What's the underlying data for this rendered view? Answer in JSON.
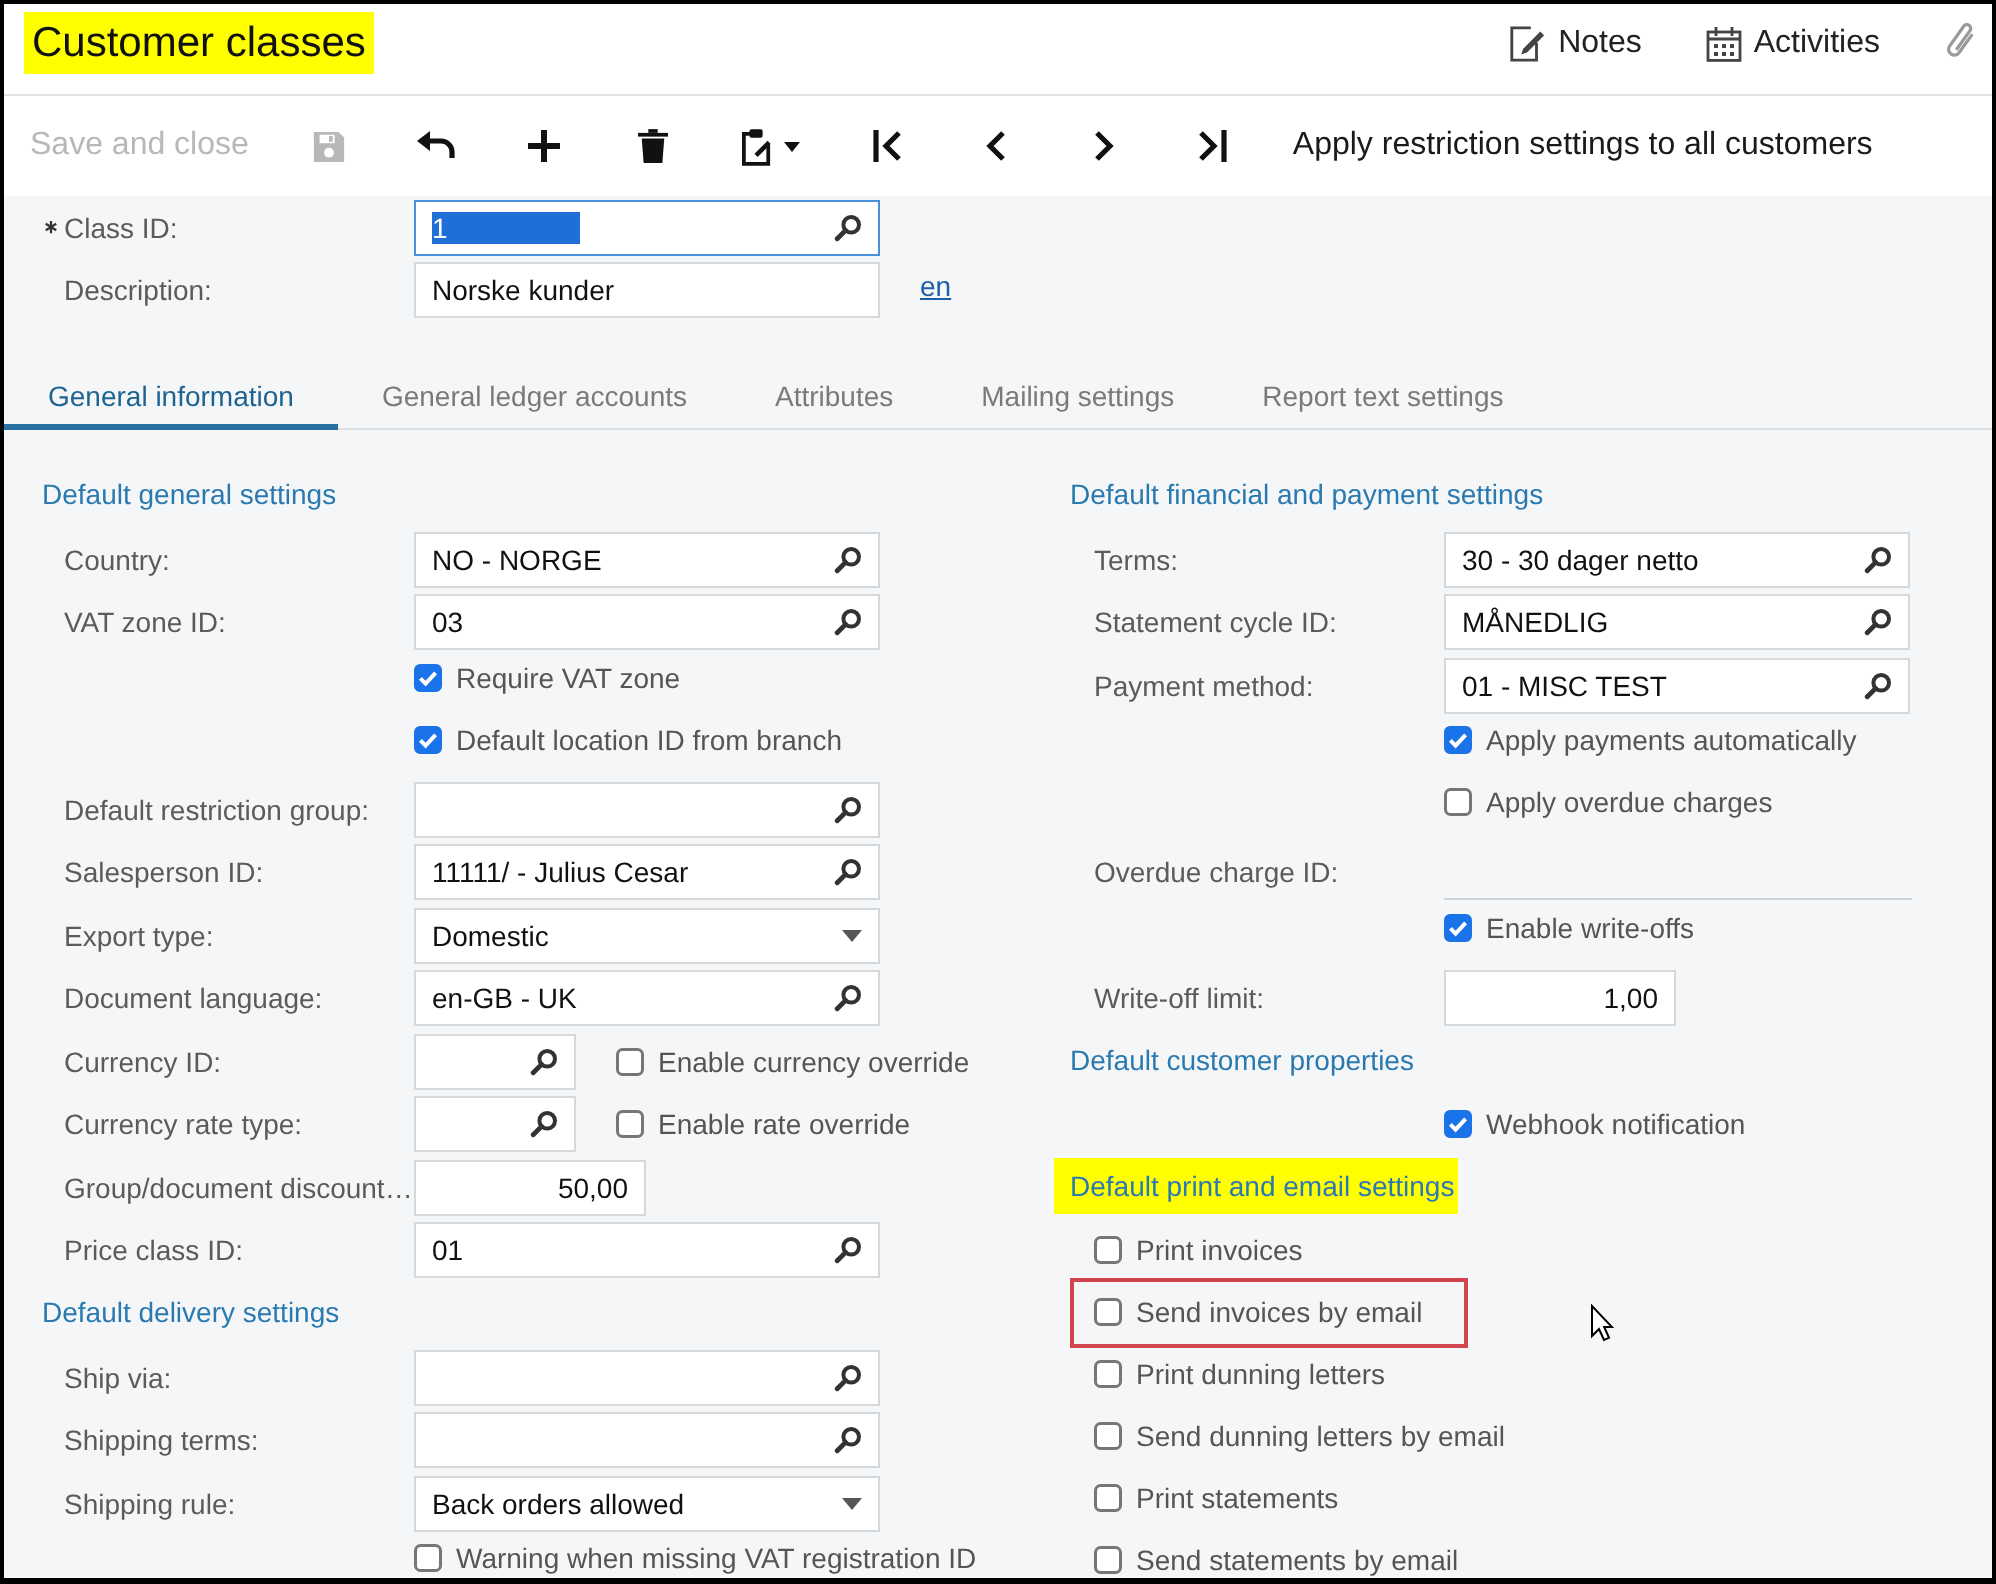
{
  "header": {
    "title": "Customer classes",
    "highlighted": true,
    "actions": [
      {
        "kind": "notes",
        "label": "Notes"
      },
      {
        "kind": "activities",
        "label": "Activities"
      },
      {
        "kind": "attachment"
      }
    ]
  },
  "toolbar": [
    {
      "kind": "text",
      "label": "Save and close",
      "disabled": true
    },
    {
      "kind": "save",
      "disabled": true
    },
    {
      "kind": "undo",
      "disabled": false
    },
    {
      "kind": "add",
      "disabled": false
    },
    {
      "kind": "delete",
      "disabled": false
    },
    {
      "kind": "clipboard",
      "disabled": false
    },
    {
      "kind": "first",
      "disabled": false
    },
    {
      "kind": "previous",
      "disabled": false
    },
    {
      "kind": "next",
      "disabled": false
    },
    {
      "kind": "last",
      "disabled": false
    },
    {
      "kind": "text",
      "label": "Apply restriction settings to all customers",
      "disabled": false
    }
  ],
  "summary": [
    {
      "label": "Class ID:",
      "required": true,
      "field": {
        "kind": "lookup",
        "value": "1",
        "focused": true
      }
    },
    {
      "label": "Description:",
      "required": false,
      "field": {
        "kind": "text",
        "value": "Norske kunder",
        "focused": false
      },
      "link": "en"
    }
  ],
  "tabs": [
    {
      "label": "General information",
      "selected": true
    },
    {
      "label": "General ledger accounts",
      "selected": false
    },
    {
      "label": "Attributes",
      "selected": false
    },
    {
      "label": "Mailing settings",
      "selected": false
    },
    {
      "label": "Report text settings",
      "selected": false
    }
  ],
  "columns": [
    {
      "sections": [
        {
          "title": "Default general settings",
          "highlighted": false,
          "rows": [
            {
              "kind": "field",
              "label": "Country:",
              "field": {
                "kind": "lookup",
                "value": "NO - NORGE"
              }
            },
            {
              "kind": "field",
              "label": "VAT zone ID:",
              "field": {
                "kind": "lookup",
                "value": "03"
              }
            },
            {
              "kind": "checkbox",
              "label": "Require VAT zone",
              "checked": true
            },
            {
              "kind": "checkbox",
              "label": "Default location ID from branch",
              "checked": true
            },
            {
              "kind": "field",
              "label": "Default restriction group:",
              "field": {
                "kind": "lookup"
              }
            },
            {
              "kind": "field",
              "label": "Salesperson ID:",
              "field": {
                "kind": "lookup",
                "value": "11111/ - Julius Cesar"
              }
            },
            {
              "kind": "field",
              "label": "Export type:",
              "field": {
                "kind": "select",
                "value": "Domestic"
              }
            },
            {
              "kind": "field",
              "label": "Document language:",
              "field": {
                "kind": "lookup",
                "value": "en-GB - UK"
              }
            },
            {
              "kind": "field",
              "label": "Currency ID:",
              "field": {
                "kind": "lookup"
              },
              "option": {
                "label": "Enable currency override",
                "checked": false
              }
            },
            {
              "kind": "field",
              "label": "Currency rate type:",
              "field": {
                "kind": "lookup"
              },
              "option": {
                "label": "Enable rate override",
                "checked": false
              }
            },
            {
              "kind": "field",
              "label": "Group/document discount…",
              "field": {
                "kind": "number",
                "value": "50,00"
              }
            },
            {
              "kind": "field",
              "label": "Price class ID:",
              "field": {
                "kind": "lookup",
                "value": "01"
              }
            }
          ]
        },
        {
          "title": "Default delivery settings",
          "highlighted": false,
          "rows": [
            {
              "kind": "field",
              "label": "Ship via:",
              "field": {
                "kind": "lookup"
              }
            },
            {
              "kind": "field",
              "label": "Shipping terms:",
              "field": {
                "kind": "lookup"
              }
            },
            {
              "kind": "field",
              "label": "Shipping rule:",
              "field": {
                "kind": "select",
                "value": "Back orders allowed"
              }
            },
            {
              "kind": "checkbox",
              "label": "Warning when missing VAT registration ID",
              "checked": false
            }
          ]
        }
      ]
    },
    {
      "sections": [
        {
          "title": "Default financial and payment settings",
          "highlighted": false,
          "rows": [
            {
              "kind": "field",
              "label": "Terms:",
              "field": {
                "kind": "lookup",
                "value": "30 - 30 dager netto"
              }
            },
            {
              "kind": "field",
              "label": "Statement cycle ID:",
              "field": {
                "kind": "lookup",
                "value": "MÅNEDLIG"
              }
            },
            {
              "kind": "field",
              "label": "Payment method:",
              "field": {
                "kind": "lookup",
                "value": "01 - MISC TEST"
              }
            },
            {
              "kind": "checkbox",
              "label": "Apply payments automatically",
              "checked": true
            },
            {
              "kind": "checkbox",
              "label": "Apply overdue charges",
              "checked": false
            },
            {
              "kind": "field",
              "label": "Overdue charge ID:",
              "field": {
                "kind": "readonly"
              }
            },
            {
              "kind": "checkbox",
              "label": "Enable write-offs",
              "checked": true
            },
            {
              "kind": "field",
              "label": "Write-off limit:",
              "field": {
                "kind": "number",
                "value": "1,00"
              }
            }
          ]
        },
        {
          "title": "Default customer properties",
          "highlighted": false,
          "rows": [
            {
              "kind": "checkbox",
              "label": "Webhook notification",
              "checked": true
            }
          ]
        },
        {
          "title": "Default print and email settings",
          "highlighted": true,
          "rows": [
            {
              "kind": "option",
              "label": "Print invoices",
              "checked": false,
              "outlined": false
            },
            {
              "kind": "option",
              "label": "Send invoices by email",
              "checked": false,
              "outlined": true
            },
            {
              "kind": "option",
              "label": "Print dunning letters",
              "checked": false,
              "outlined": false
            },
            {
              "kind": "option",
              "label": "Send dunning letters by email",
              "checked": false,
              "outlined": false
            },
            {
              "kind": "option",
              "label": "Print statements",
              "checked": false,
              "outlined": false
            },
            {
              "kind": "option",
              "label": "Send statements by email",
              "checked": false,
              "outlined": false
            }
          ]
        }
      ]
    }
  ]
}
